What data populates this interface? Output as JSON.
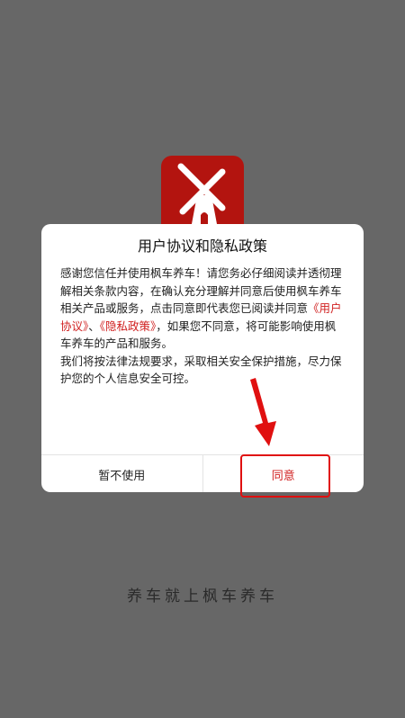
{
  "dialog": {
    "title": "用户协议和隐私政策",
    "para1_a": "感谢您信任并使用枫车养车！请您务必仔细阅读并透彻理解相关条款内容，在确认充分理解并同意后使用枫车养车相关产品或服务，点击同意即代表您已阅读并同意",
    "link_user_agreement": "《用户协议》",
    "sep": "、",
    "link_privacy": "《隐私政策》",
    "para1_b": "，如果您不同意，将可能影响使用枫车养车的产品和服务。",
    "para2": "我们将按法律法规要求，采取相关安全保护措施，尽力保护您的个人信息安全可控。",
    "cancel_label": "暂不使用",
    "agree_label": "同意"
  },
  "splash": {
    "logo_icon": "windmill-icon",
    "slogan": "养车就上枫车养车"
  },
  "colors": {
    "overlay": "#676767",
    "brand_red": "#b3140f",
    "link_red": "#d01f1f"
  }
}
